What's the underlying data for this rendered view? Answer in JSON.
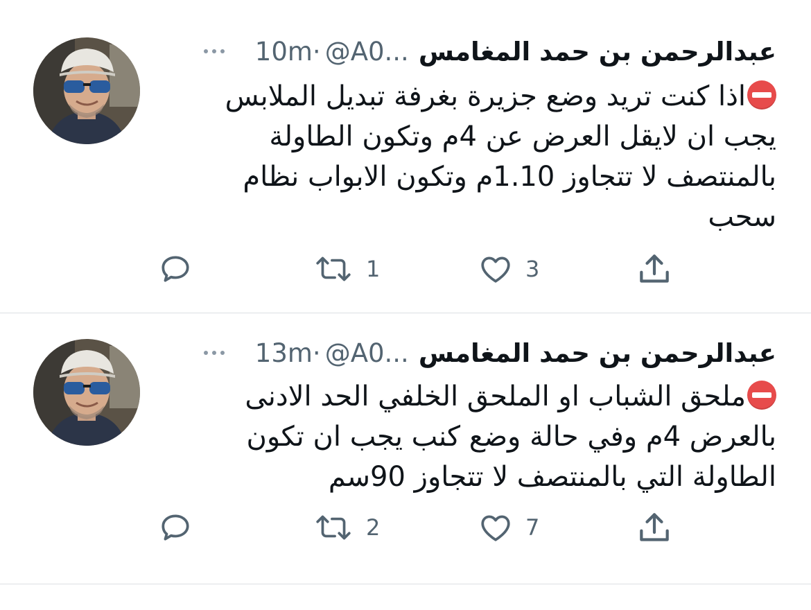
{
  "tweets": [
    {
      "author_name": "عبدالرحمن بن حمد المغامس",
      "handle": "@A0...",
      "separator": "·",
      "time": "10m",
      "text": "اذا كنت تريد وضع جزيرة بغرفة تبديل الملابس يجب ان لايقل العرض عن 4م وتكون الطاولة بالمنتصف لا تتجاوز 1.10م وتكون الابواب نظام سحب",
      "leading_icon": "no-entry-icon",
      "retweets": "1",
      "likes": "3"
    },
    {
      "author_name": "عبدالرحمن بن حمد المغامس",
      "handle": "@A0...",
      "separator": "·",
      "time": "13m",
      "text": "ملحق الشباب او الملحق الخلفي الحد الادنى بالعرض 4م وفي حالة وضع كنب يجب ان تكون الطاولة التي بالمنتصف لا تتجاوز 90سم",
      "leading_icon": "no-entry-icon",
      "retweets": "2",
      "likes": "7"
    }
  ],
  "colors": {
    "text": "#0f1419",
    "secondary": "#536471",
    "divider": "#dcdfe3",
    "no_entry_red": "#e74b4b"
  },
  "icons": [
    "reply-icon",
    "retweet-icon",
    "like-icon",
    "share-icon",
    "more-icon",
    "no-entry-icon"
  ]
}
